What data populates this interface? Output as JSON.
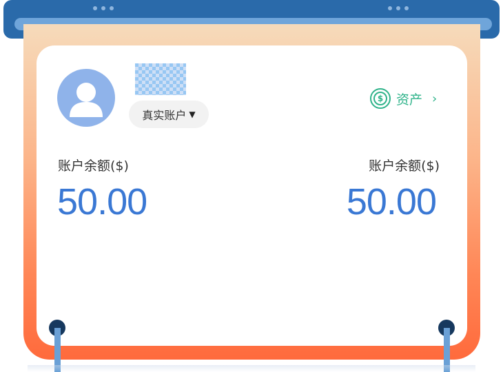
{
  "account": {
    "type_label": "真实账户",
    "assets_label": "资产",
    "assets_chevron": "›",
    "coin_symbol": "$"
  },
  "balances": [
    {
      "label": "账户余额($)",
      "value": "50.00"
    },
    {
      "label": "账户余额($)",
      "value": "50.00"
    }
  ],
  "colors": {
    "accent_blue": "#3a78d4",
    "accent_green": "#2fb38a",
    "frame_top": "#f6dbbb",
    "frame_bottom": "#ff6a3c",
    "header_blue": "#2a6aaa"
  },
  "icons": {
    "avatar": "user-silhouette-icon",
    "assets": "dollar-coin-icon",
    "dropdown": "caret-down-icon"
  }
}
